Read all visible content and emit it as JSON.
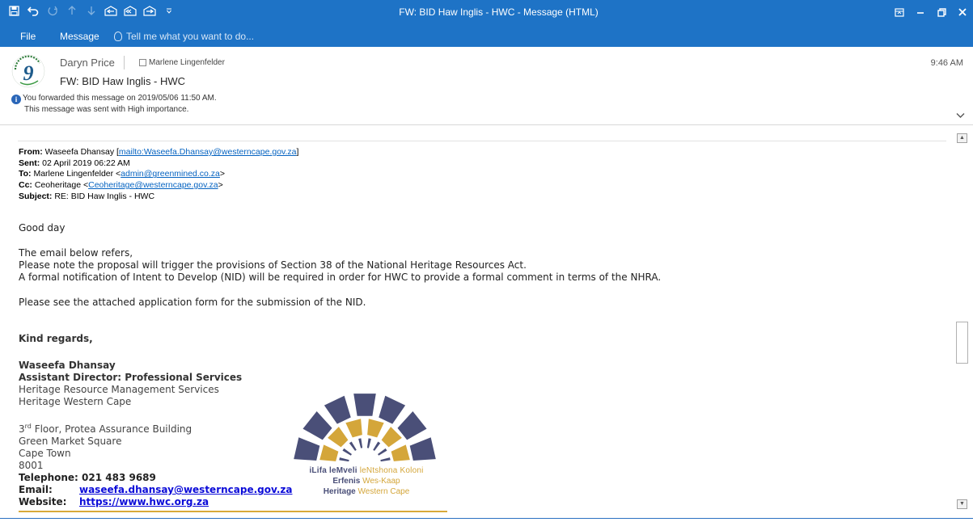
{
  "window": {
    "title": "FW: BID Haw Inglis - HWC - Message (HTML)",
    "qat_icons": [
      "save-icon",
      "undo-icon",
      "redo-icon",
      "up-arrow-icon",
      "down-arrow-icon",
      "reply-icon",
      "reply-all-icon",
      "forward-icon",
      "customize-icon"
    ],
    "controls": [
      "ribbon-display-icon",
      "minimize-icon",
      "restore-icon",
      "close-icon"
    ]
  },
  "ribbon": {
    "file": "File",
    "message": "Message",
    "tellme": "Tell me what you want to do..."
  },
  "header": {
    "sender": "Daryn Price",
    "recipient": "Marlene Lingenfelder",
    "subject": "FW: BID Haw Inglis - HWC",
    "time": "9:46 AM",
    "info_line1": "You forwarded this message on 2019/05/06 11:50 AM.",
    "info_line2": "This message was sent with High importance.",
    "logo_text": "greenmined"
  },
  "forwarded": {
    "from_label": "From:",
    "from_name": "Waseefa Dhansay [",
    "from_link": "mailto:Waseefa.Dhansay@westerncape.gov.za",
    "from_close": "]",
    "sent_label": "Sent:",
    "sent": "02 April 2019 06:22 AM",
    "to_label": "To:",
    "to_name": "Marlene Lingenfelder <",
    "to_link": "admin@greenmined.co.za",
    "to_close": ">",
    "cc_label": "Cc:",
    "cc_name": "Ceoheritage <",
    "cc_link": "Ceoheritage@westerncape.gov.za",
    "cc_close": ">",
    "subject_label": "Subject:",
    "subject": "RE: BID Haw Inglis - HWC"
  },
  "body": {
    "greeting": "Good day",
    "p1": "The email below refers,",
    "p2": "Please note the proposal will trigger the provisions of Section 38 of the National Heritage Resources Act.",
    "p3": "A formal notification of Intent to Develop (NID) will be required in order for HWC to provide a formal comment in terms of the NHRA.",
    "p4": "Please see the attached application form for the submission of the NID.",
    "regards": "Kind regards,"
  },
  "signature": {
    "name": "Waseefa Dhansay",
    "title": "Assistant Director: Professional Services",
    "dept": "Heritage Resource Management Services",
    "org": "Heritage Western Cape",
    "floor_num": "3",
    "floor_sup": "rd",
    "floor_rest": " Floor, Protea Assurance Building",
    "addr2": "Green Market Square",
    "addr3": "Cape Town",
    "addr4": "8001",
    "telephone": "Telephone: 021 483 9689",
    "email_label": "Email:",
    "email": "waseefa.dhansay@westerncape.gov.za",
    "website_label": "Website:",
    "website": "https://www.hwc.org.za"
  },
  "hwc_logo": {
    "line1_a": "iLifa leMveli ",
    "line1_b": "leNtshona Koloni",
    "line2_a": "Erfenis ",
    "line2_b": "Wes-Kaap",
    "line3_a": "Heritage ",
    "line3_b": "Western Cape",
    "colors": {
      "navy": "#4a4f78",
      "gold": "#d4a63a"
    }
  },
  "colors": {
    "accent": "#1e73c6",
    "link": "#0563c1"
  }
}
